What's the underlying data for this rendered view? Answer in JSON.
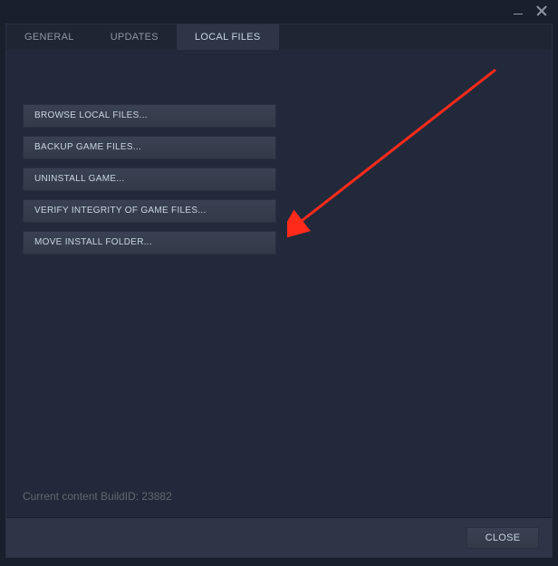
{
  "tabs": {
    "general": "GENERAL",
    "updates": "UPDATES",
    "local_files": "LOCAL FILES",
    "active_index": 2
  },
  "local_files": {
    "actions": {
      "browse": "BROWSE LOCAL FILES...",
      "backup": "BACKUP GAME FILES...",
      "uninstall": "UNINSTALL GAME...",
      "verify": "VERIFY INTEGRITY OF GAME FILES...",
      "move": "MOVE INSTALL FOLDER..."
    },
    "build_info": "Current content BuildID: 23882"
  },
  "footer": {
    "close": "CLOSE"
  },
  "annotation": {
    "arrow_points_to": "verify-integrity-button",
    "color": "#ff2a1a"
  }
}
